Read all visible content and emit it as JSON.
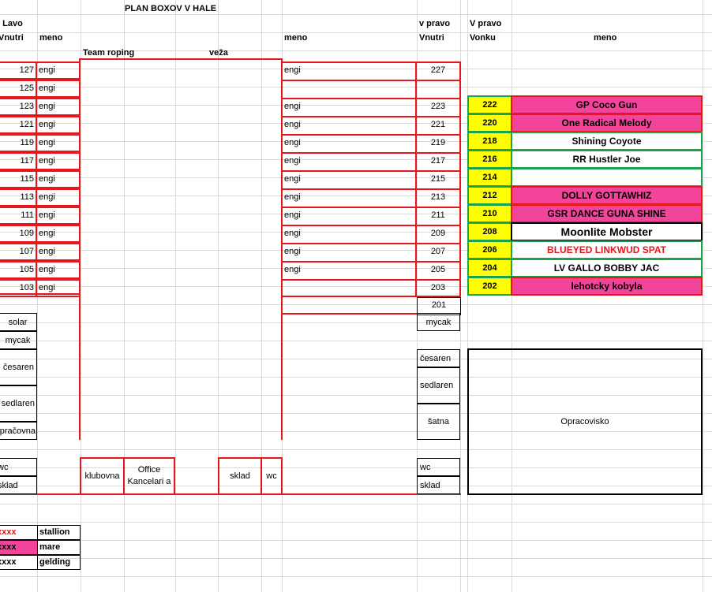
{
  "title": "PLAN BOXOV  V HALE",
  "headers": {
    "left_top": "v Lavo",
    "left_inner": "Vnutri",
    "meno": "meno",
    "right_top": "v pravo",
    "right_inner": "Vnutri",
    "outer_top": "V pravo",
    "outer": "Vonku",
    "outer_meno": "meno",
    "team_roping": "Team roping",
    "veza": "veža"
  },
  "left_boxes": [
    {
      "num": "127",
      "name": "engi"
    },
    {
      "num": "125",
      "name": "engi"
    },
    {
      "num": "123",
      "name": "engi"
    },
    {
      "num": "121",
      "name": "engi"
    },
    {
      "num": "119",
      "name": "engi"
    },
    {
      "num": "117",
      "name": "engi"
    },
    {
      "num": "115",
      "name": "engi"
    },
    {
      "num": "113",
      "name": "engi"
    },
    {
      "num": "111",
      "name": "engi"
    },
    {
      "num": "109",
      "name": "engi"
    },
    {
      "num": "107",
      "name": "engi"
    },
    {
      "num": "105",
      "name": "engi"
    },
    {
      "num": "103",
      "name": "engi"
    }
  ],
  "right_inner_boxes": [
    {
      "num": "227",
      "name": "engi"
    },
    {
      "num": "",
      "name": ""
    },
    {
      "num": "223",
      "name": "engi"
    },
    {
      "num": "221",
      "name": "engi"
    },
    {
      "num": "219",
      "name": "engi"
    },
    {
      "num": "217",
      "name": "engi"
    },
    {
      "num": "215",
      "name": "engi"
    },
    {
      "num": "213",
      "name": "engi"
    },
    {
      "num": "211",
      "name": "engi"
    },
    {
      "num": "209",
      "name": "engi"
    },
    {
      "num": "207",
      "name": "engi"
    },
    {
      "num": "205",
      "name": "engi"
    },
    {
      "num": "203",
      "name": ""
    },
    {
      "num": "201",
      "name": ""
    }
  ],
  "outer_boxes": [
    {
      "num": "222",
      "name": "GP Coco Gun",
      "type": "mare"
    },
    {
      "num": "220",
      "name": "One Radical Melody",
      "type": "mare"
    },
    {
      "num": "218",
      "name": "Shining Coyote",
      "type": "gelding"
    },
    {
      "num": "216",
      "name": "RR Hustler Joe",
      "type": "gelding"
    },
    {
      "num": "214",
      "name": "",
      "type": "empty"
    },
    {
      "num": "212",
      "name": "DOLLY GOTTAWHIZ",
      "type": "mare"
    },
    {
      "num": "210",
      "name": "GSR DANCE GUNA SHINE",
      "type": "mare"
    },
    {
      "num": "208",
      "name": "Moonlite Mobster",
      "type": "big"
    },
    {
      "num": "206",
      "name": "BLUEYED LINKWUD SPAT",
      "type": "stallion"
    },
    {
      "num": "204",
      "name": "LV GALLO BOBBY JAC",
      "type": "gelding"
    },
    {
      "num": "202",
      "name": "lehotcky kobyla",
      "type": "mare"
    }
  ],
  "left_rooms": [
    "solar",
    "mycak",
    "česaren",
    "sedlaren",
    "opračovna"
  ],
  "right_rooms": [
    "mycak",
    "česaren",
    "sedlaren",
    "šatna"
  ],
  "bottom_rooms": {
    "left_wc": "wc",
    "left_sklad": "sklad",
    "klubovna": "klubovna",
    "office": "Office Kancelari a",
    "sklad": "sklad",
    "wc": "wc",
    "right_wc": "wc",
    "right_sklad": "sklad"
  },
  "arena": "Opracovisko",
  "legend": [
    {
      "mark": "xxxx",
      "label": "stallion"
    },
    {
      "mark": "xxxx",
      "label": "mare"
    },
    {
      "mark": "xxxx",
      "label": "gelding"
    }
  ],
  "colors": {
    "red": "#e8151b",
    "pink": "#f2449a",
    "yellow": "#ffff00",
    "green": "#1aa34a"
  }
}
